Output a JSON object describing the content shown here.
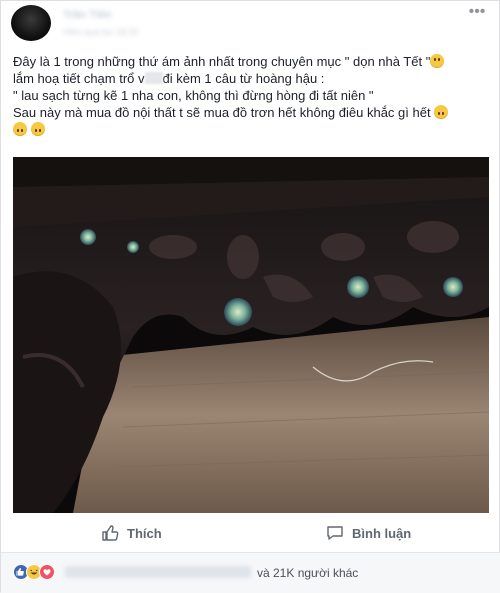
{
  "post": {
    "author": "Trần Tiên",
    "meta": "Hôm qua lúc 18:20",
    "more_icon": "ellipsis-icon",
    "text_line1": "Đây là 1 trong những thứ ám ảnh nhất trong chuyên mục \" dọn nhà Tết \"",
    "text_line2a": "lắm hoạ tiết chạm trổ v",
    "text_line2b": "đi kèm 1 câu từ hoàng hậu :",
    "text_line3": "\" lau sạch từng kẽ 1 nha con, không thì đừng hòng đi tất niên \"",
    "text_line4": "Sau này mà mua đồ nội thất t sẽ mua đồ trơn hết không điêu khắc gì hết"
  },
  "actions": {
    "like_label": "Thích",
    "comment_label": "Bình luận",
    "like_icon": "thumbs-up-icon",
    "comment_icon": "comment-icon"
  },
  "reactions": {
    "summary": "và 21K người khác",
    "icons": [
      "like-reaction-icon",
      "haha-reaction-icon",
      "love-reaction-icon"
    ]
  },
  "colors": {
    "text": "#1d2129",
    "secondary": "#606770",
    "like_blue": "#4267b2",
    "haha_yellow": "#f7c843",
    "love_red": "#f25268"
  }
}
